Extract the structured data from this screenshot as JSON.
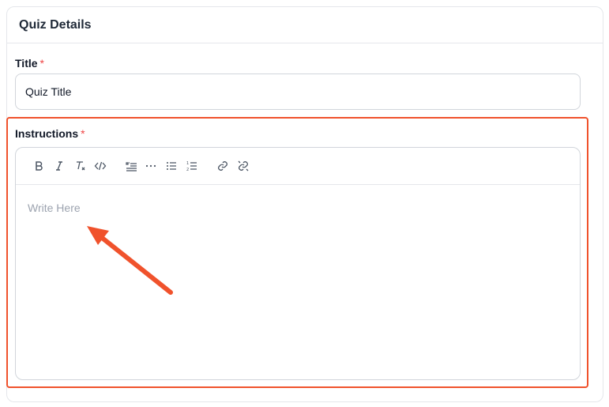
{
  "card": {
    "title": "Quiz Details"
  },
  "title_field": {
    "label": "Title",
    "required_mark": "*",
    "value": "Quiz Title"
  },
  "instructions_field": {
    "label": "Instructions",
    "required_mark": "*",
    "placeholder": "Write Here",
    "toolbar": [
      "bold-icon",
      "italic-icon",
      "clear-format-icon",
      "code-icon",
      "blockquote-icon",
      "horizontal-rule-icon",
      "bullet-list-icon",
      "ordered-list-icon",
      "link-icon",
      "unlink-icon"
    ]
  },
  "colors": {
    "accent": "#f0522c",
    "required": "#ef4444",
    "placeholder": "#9ca3af",
    "border": "#d1d5db"
  }
}
